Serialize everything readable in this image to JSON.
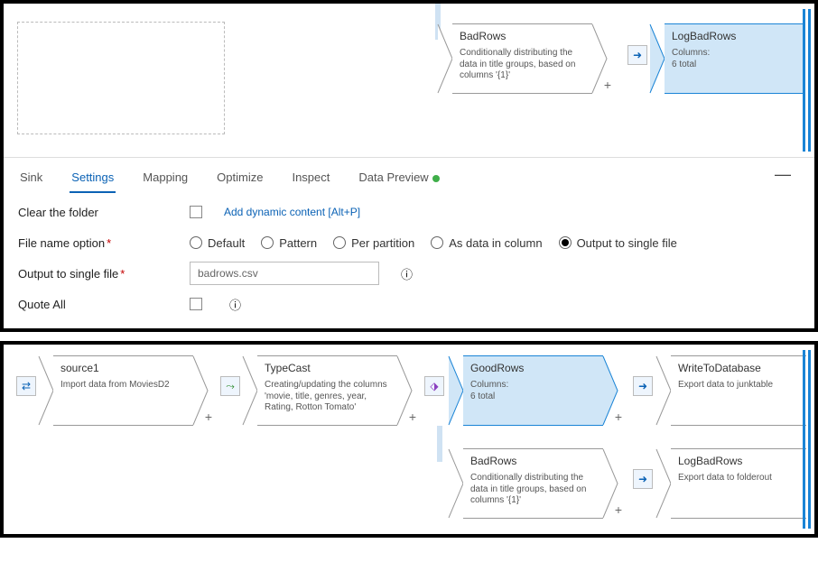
{
  "panel1": {
    "nodes": {
      "badrows": {
        "title": "BadRows",
        "desc": "Conditionally distributing the data in title groups, based on columns '{1}'"
      },
      "logbadrows": {
        "title": "LogBadRows",
        "columns_label": "Columns:",
        "columns_value": "6 total"
      }
    }
  },
  "tabs": {
    "sink": "Sink",
    "settings": "Settings",
    "mapping": "Mapping",
    "optimize": "Optimize",
    "inspect": "Inspect",
    "data_preview": "Data Preview"
  },
  "form": {
    "clear_folder": "Clear the folder",
    "add_dynamic": "Add dynamic content [Alt+P]",
    "fno_label": "File name option",
    "opts": {
      "default": "Default",
      "pattern": "Pattern",
      "per_partition": "Per partition",
      "as_data": "As data in column",
      "single": "Output to single file"
    },
    "single_label": "Output to single file",
    "single_value": "badrows.csv",
    "quote_all": "Quote All"
  },
  "panel2": {
    "source1": {
      "title": "source1",
      "desc": "Import data from MoviesD2"
    },
    "typecast": {
      "title": "TypeCast",
      "desc": "Creating/updating the columns 'movie, title, genres, year, Rating, Rotton Tomato'"
    },
    "goodrows": {
      "title": "GoodRows",
      "columns_label": "Columns:",
      "columns_value": "6 total"
    },
    "writedb": {
      "title": "WriteToDatabase",
      "desc": "Export data to junktable"
    },
    "badrows": {
      "title": "BadRows",
      "desc": "Conditionally distributing the data in title groups, based on columns '{1}'"
    },
    "logbadrows": {
      "title": "LogBadRows",
      "desc": "Export data to folderout"
    }
  }
}
